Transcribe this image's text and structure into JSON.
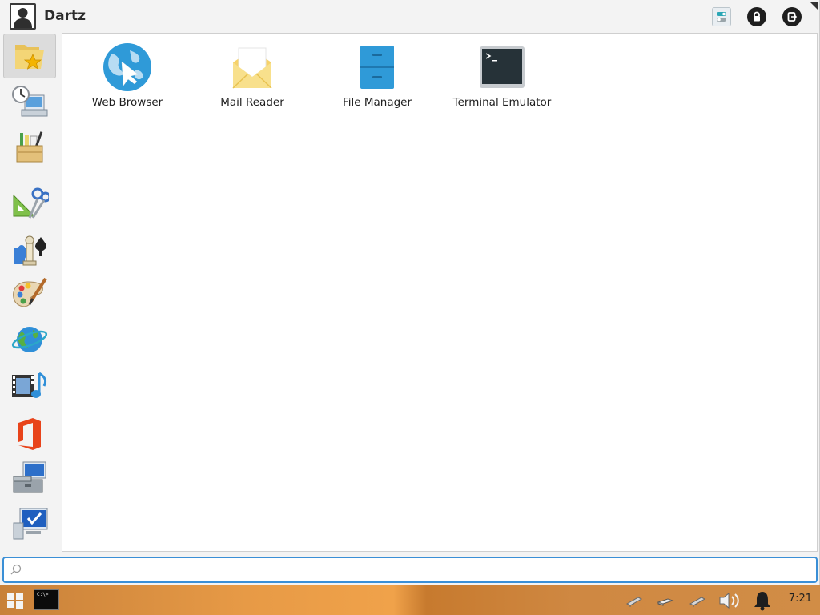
{
  "header": {
    "username": "Dartz",
    "buttons": [
      "settings-icon",
      "lock-screen-icon",
      "log-out-icon"
    ]
  },
  "sidebar": {
    "categories": [
      {
        "name": "Favorites",
        "icon": "favorites-folder-icon",
        "active": true
      },
      {
        "name": "Recently Used",
        "icon": "recent-clock-icon"
      },
      {
        "name": "All Applications",
        "icon": "all-apps-box-icon"
      },
      {
        "name": "Accessories",
        "icon": "accessories-icon"
      },
      {
        "name": "Games",
        "icon": "games-icon"
      },
      {
        "name": "Graphics",
        "icon": "graphics-palette-icon"
      },
      {
        "name": "Internet",
        "icon": "internet-globe-icon"
      },
      {
        "name": "Multimedia",
        "icon": "multimedia-icon"
      },
      {
        "name": "Office",
        "icon": "office-icon"
      },
      {
        "name": "Settings",
        "icon": "settings-toolbox-icon"
      },
      {
        "name": "System",
        "icon": "system-monitor-icon"
      }
    ]
  },
  "apps": [
    {
      "label": "Web Browser",
      "icon": "web-browser-icon"
    },
    {
      "label": "Mail Reader",
      "icon": "mail-reader-icon"
    },
    {
      "label": "File Manager",
      "icon": "file-manager-icon"
    },
    {
      "label": "Terminal Emulator",
      "icon": "terminal-emulator-icon"
    }
  ],
  "search": {
    "value": "",
    "placeholder": ""
  },
  "taskbar": {
    "terminal_text": "C:\\>_",
    "clock": "7:21"
  },
  "colors": {
    "accent": "#3a8fd6",
    "taskbar": "#e79a46"
  }
}
